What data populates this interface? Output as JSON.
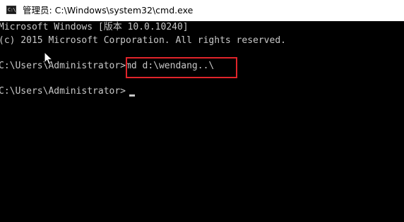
{
  "window": {
    "title": "管理员: C:\\Windows\\system32\\cmd.exe",
    "icon": "console-icon"
  },
  "console": {
    "line1": "Microsoft Windows [版本 10.0.10240]",
    "line2": "(c) 2015 Microsoft Corporation. All rights reserved.",
    "prompt1": "C:\\Users\\Administrator>",
    "command1": "md d:\\wendang..\\",
    "prompt2": "C:\\Users\\Administrator>",
    "text_color": "#c8c8c8",
    "background": "#000000"
  },
  "annotation": {
    "box_color": "#e0242a"
  },
  "cursor_icon": "mouse-pointer-icon"
}
